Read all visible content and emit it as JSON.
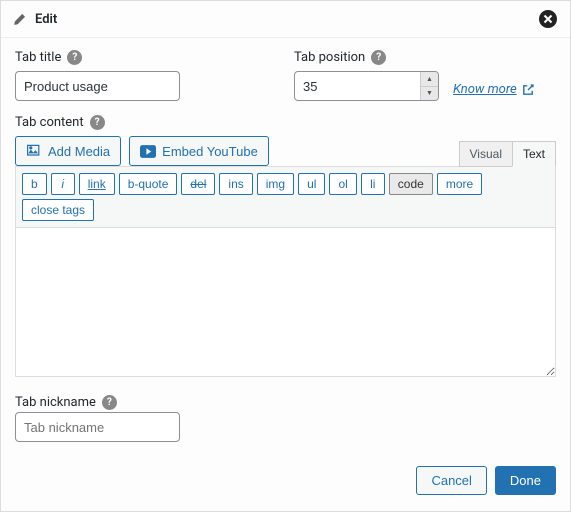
{
  "header": {
    "title": "Edit"
  },
  "labels": {
    "tab_title": "Tab title",
    "tab_position": "Tab position",
    "tab_content": "Tab content",
    "tab_nickname": "Tab nickname"
  },
  "values": {
    "tab_title": "Product usage",
    "tab_position": "35",
    "content": "",
    "nickname": ""
  },
  "placeholders": {
    "nickname": "Tab nickname"
  },
  "links": {
    "know_more": "Know more"
  },
  "buttons": {
    "add_media": "Add Media",
    "embed_youtube": "Embed YouTube",
    "cancel": "Cancel",
    "done": "Done"
  },
  "editor_tabs": {
    "visual": "Visual",
    "text": "Text",
    "active": "text"
  },
  "toolbar": {
    "b": "b",
    "i": "i",
    "link": "link",
    "bquote": "b-quote",
    "del": "del",
    "ins": "ins",
    "img": "img",
    "ul": "ul",
    "ol": "ol",
    "li": "li",
    "code": "code",
    "more": "more",
    "close_tags": "close tags"
  },
  "colors": {
    "accent": "#2271b1"
  }
}
